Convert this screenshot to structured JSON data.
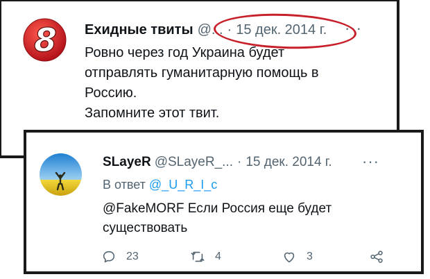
{
  "tweet1": {
    "author_name": "Ехидные твиты",
    "handle": "@...",
    "separator": "·",
    "date": "15 дек. 2014 г.",
    "more": "···",
    "text_lines": [
      "Ровно через год Украина будет",
      "отправлять гуманитарную помощь в",
      "Россию.",
      "Запомните этот твит."
    ],
    "logo_icon": "channel-8-logo",
    "highlight_color": "#c8202a"
  },
  "tweet2": {
    "author_name": "SLayeR",
    "handle": "@SLayeR_...",
    "separator": "·",
    "date": "15 дек. 2014 г.",
    "more": "···",
    "reply_prefix": "В ответ",
    "reply_to": "@_U_R_I_c",
    "text_lines": [
      "@FakeMORF Если Россия еще будет",
      "существовать"
    ],
    "actions": {
      "replies": "23",
      "retweets": "4",
      "likes": "3"
    }
  },
  "colors": {
    "text": "#0f1419",
    "secondary": "#536471",
    "link": "#1d9bf0"
  }
}
